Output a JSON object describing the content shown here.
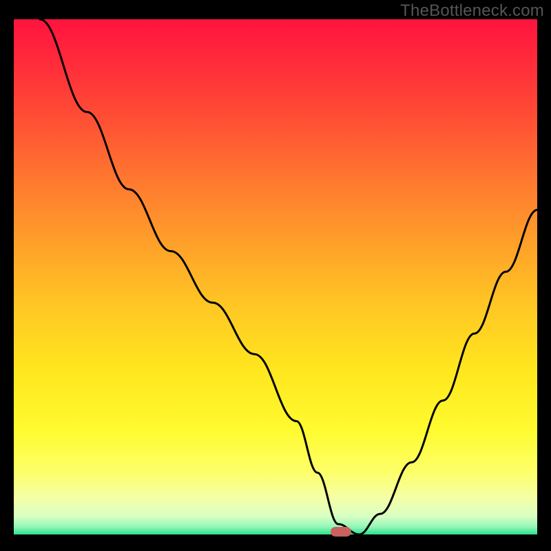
{
  "watermark": "TheBottleneck.com",
  "gradient": {
    "stops": [
      {
        "offset": 0.0,
        "color": "#ff133f"
      },
      {
        "offset": 0.08,
        "color": "#ff2a3a"
      },
      {
        "offset": 0.18,
        "color": "#ff4a35"
      },
      {
        "offset": 0.3,
        "color": "#ff7430"
      },
      {
        "offset": 0.42,
        "color": "#ff9b2a"
      },
      {
        "offset": 0.55,
        "color": "#ffc524"
      },
      {
        "offset": 0.68,
        "color": "#ffe61e"
      },
      {
        "offset": 0.8,
        "color": "#fffb30"
      },
      {
        "offset": 0.88,
        "color": "#fdff6a"
      },
      {
        "offset": 0.93,
        "color": "#f4ffa8"
      },
      {
        "offset": 0.965,
        "color": "#d8ffc2"
      },
      {
        "offset": 0.985,
        "color": "#93f7b8"
      },
      {
        "offset": 1.0,
        "color": "#2de28c"
      }
    ]
  },
  "chart_data": {
    "type": "line",
    "title": "",
    "xlabel": "",
    "ylabel": "",
    "xlim": [
      0,
      100
    ],
    "ylim": [
      0,
      100
    ],
    "grid": false,
    "legend": false,
    "marker": {
      "x": 62.5,
      "color": "#c9615f"
    },
    "series": [
      {
        "name": "curve",
        "x": [
          5,
          14,
          22,
          30,
          38,
          46,
          54,
          58,
          62,
          66,
          70,
          76,
          82,
          88,
          94,
          100
        ],
        "values": [
          100,
          82,
          67,
          55,
          45,
          35,
          22,
          12,
          2,
          0,
          4,
          14,
          26,
          39,
          51,
          63
        ]
      }
    ]
  }
}
